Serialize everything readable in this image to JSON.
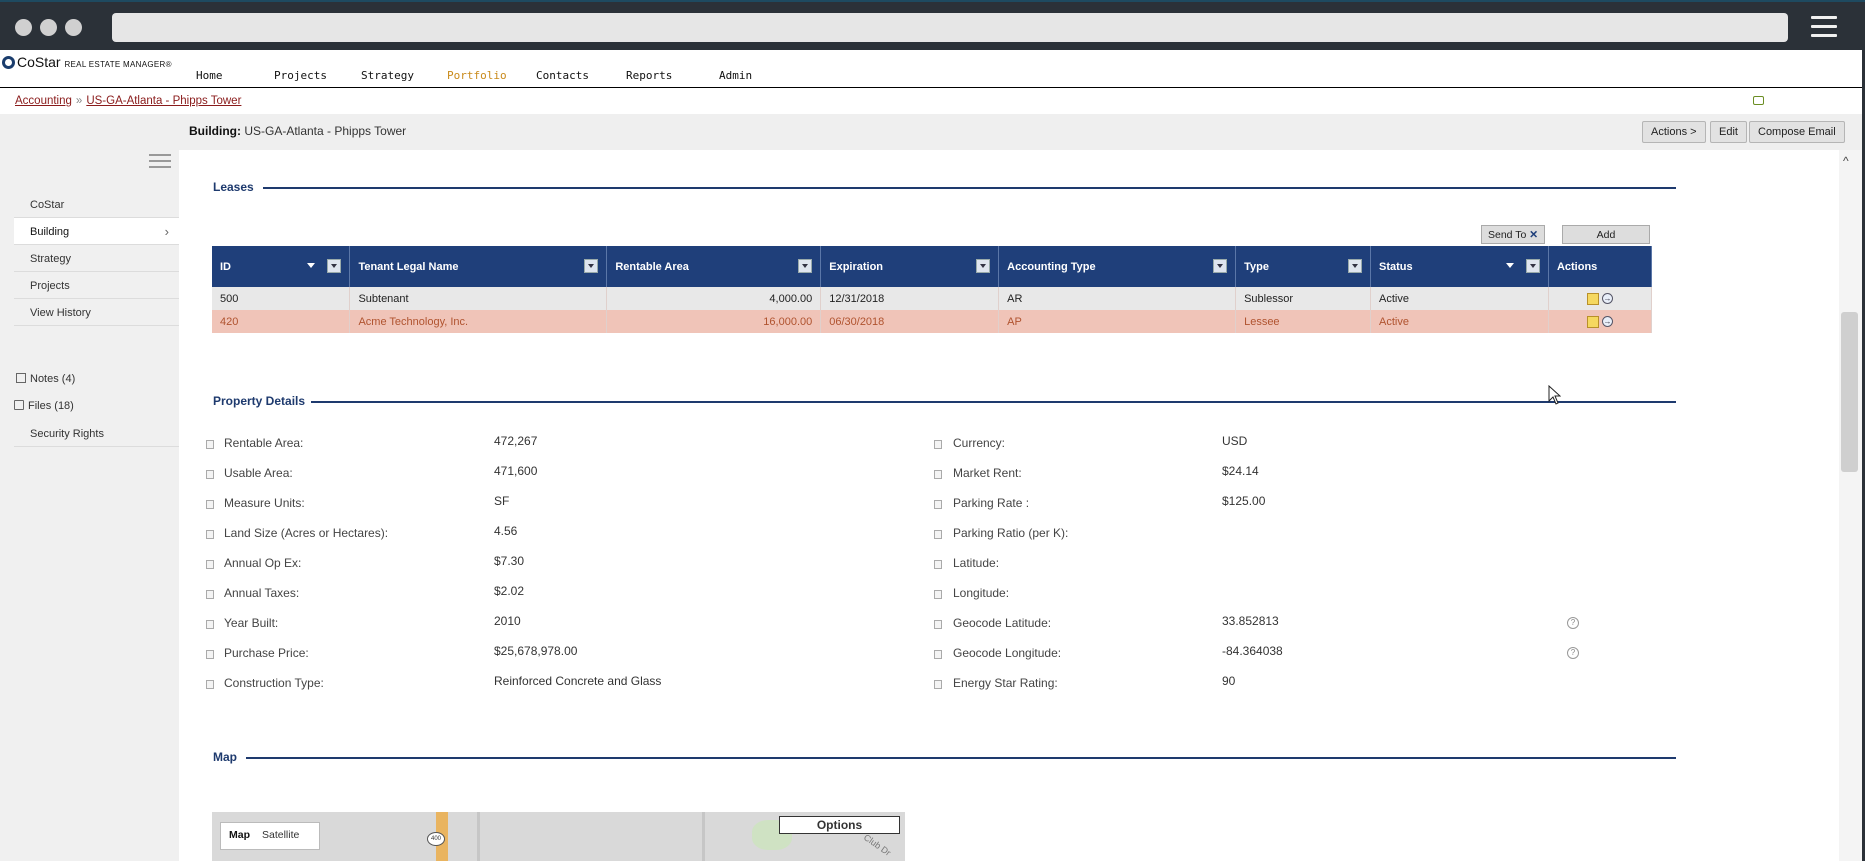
{
  "app": {
    "logo_brand": "CoStar",
    "logo_sub": "REAL ESTATE MANAGER®"
  },
  "nav": {
    "items": [
      "Home",
      "Projects",
      "Strategy",
      "Portfolio",
      "Contacts",
      "Reports",
      "Admin"
    ],
    "active": "Portfolio"
  },
  "breadcrumb": {
    "items": [
      "Accounting",
      "US-GA-Atlanta - Phipps Tower"
    ],
    "separator": "»"
  },
  "header": {
    "building_label": "Building:",
    "building_name": "US-GA-Atlanta - Phipps Tower",
    "buttons": [
      "Actions >",
      "Edit",
      "Compose Email"
    ]
  },
  "sidebar": {
    "items": [
      "CoStar",
      "Building",
      "Strategy",
      "Projects",
      "View History"
    ],
    "selected": "Building",
    "links": [
      "Notes (4)",
      "Files (18)",
      "Security Rights"
    ]
  },
  "leases": {
    "title": "Leases",
    "send_to_label": "Send To",
    "add_label": "Add",
    "columns": [
      "ID",
      "Tenant Legal Name",
      "Rentable Area",
      "Expiration",
      "Accounting Type",
      "Type",
      "Status",
      "Actions"
    ],
    "rows": [
      {
        "id": "500",
        "tenant": "Subtenant",
        "area": "4,000.00",
        "expiration": "12/31/2018",
        "acct_type": "AR",
        "type": "Sublessor",
        "status": "Active"
      },
      {
        "id": "420",
        "tenant": "Acme Technology, Inc.",
        "area": "16,000.00",
        "expiration": "06/30/2018",
        "acct_type": "AP",
        "type": "Lessee",
        "status": "Active"
      }
    ]
  },
  "property_details": {
    "title": "Property Details",
    "left": [
      {
        "label": "Rentable Area:",
        "value": "472,267"
      },
      {
        "label": "Usable Area:",
        "value": "471,600"
      },
      {
        "label": "Measure Units:",
        "value": "SF"
      },
      {
        "label": "Land Size (Acres or Hectares):",
        "value": "4.56"
      },
      {
        "label": "Annual Op Ex:",
        "value": "$7.30"
      },
      {
        "label": "Annual Taxes:",
        "value": "$2.02"
      },
      {
        "label": "Year Built:",
        "value": "2010"
      },
      {
        "label": "Purchase Price:",
        "value": "$25,678,978.00"
      },
      {
        "label": "Construction Type:",
        "value": "Reinforced Concrete and Glass"
      }
    ],
    "right": [
      {
        "label": "Currency:",
        "value": "USD"
      },
      {
        "label": "Market Rent:",
        "value": "$24.14"
      },
      {
        "label": "Parking Rate :",
        "value": "$125.00"
      },
      {
        "label": "Parking Ratio (per K):",
        "value": ""
      },
      {
        "label": "Latitude:",
        "value": ""
      },
      {
        "label": "Longitude:",
        "value": ""
      },
      {
        "label": "Geocode Latitude:",
        "value": "33.852813"
      },
      {
        "label": "Geocode Longitude:",
        "value": "-84.364038"
      },
      {
        "label": "Energy Star Rating:",
        "value": "90"
      }
    ]
  },
  "map": {
    "title": "Map",
    "toggle": [
      "Map",
      "Satellite"
    ],
    "options_label": "Options",
    "route_label": "400",
    "street_label": "Club Dr"
  },
  "colors": {
    "navy": "#1f3f7a",
    "highlight_row": "#f0c4b8",
    "active_nav": "#c98a1a"
  }
}
